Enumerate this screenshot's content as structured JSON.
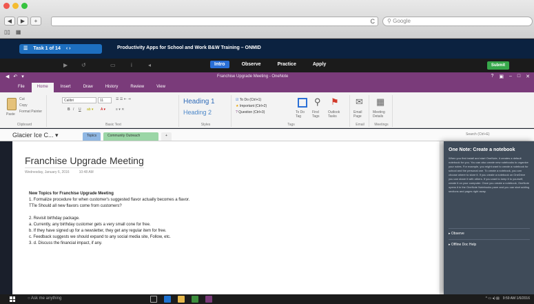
{
  "safari": {
    "search_placeholder": "Google",
    "nav_back": "◀",
    "nav_fwd": "▶",
    "add_tab": "+",
    "reload": "C"
  },
  "training": {
    "task_label": "Task 1 of 14",
    "title": "Productivity Apps for School and Work B&W Training – ONMID",
    "modes": [
      "Intro",
      "Observe",
      "Practice",
      "Apply"
    ],
    "active_mode": "Intro",
    "submit": "Submit"
  },
  "onenote": {
    "window_title": "Franchise Upgrade Meeting - OneNote",
    "tabs": [
      "File",
      "Home",
      "Insert",
      "Draw",
      "History",
      "Review",
      "View"
    ],
    "active_tab": "Home",
    "ribbon": {
      "clipboard_label": "Clipboard",
      "basic_text_label": "Basic Text",
      "styles_label": "Styles",
      "tags_label": "Tags",
      "email_label": "Email",
      "meetings_label": "Meetings",
      "cut": "Cut",
      "copy": "Copy",
      "format_painter": "Format Painter",
      "paste": "Paste",
      "font": "Calibri",
      "font_size": "11",
      "heading1": "Heading 1",
      "heading2": "Heading 2",
      "tag_todo": "To Do (Ctrl+1)",
      "tag_important": "Important (Ctrl+2)",
      "tag_question": "Question (Ctrl+3)",
      "todo_tag": "To Do Tag",
      "find_tags": "Find Tags",
      "outlook_tasks": "Outlook Tasks",
      "email_page": "Email Page",
      "meeting_details": "Meeting Details"
    },
    "notebook": "Glacier Ice C...",
    "section_tabs": [
      "Topics",
      "Community Outreach"
    ],
    "search_text": "Search (Ctrl+E)",
    "page": {
      "title": "Franchise Upgrade Meeting",
      "date": "Wednesday, January 6, 2016",
      "time": "10:48 AM",
      "heading": "New Topics for Franchise Upgrade Meeting",
      "lines": [
        "1.    Formalize procedure for when customer's suggested flavor actually becomes a flavor.",
        "       TTle    Should all new flavors come from customers?",
        "",
        "2.    Revisit birthday package.",
        "            a.    Currently, any birthday customer gets a very small cone for free.",
        "            b.    If they have signed up for a newsletter, they get any regular item for free.",
        "            c.    Feedback suggests we should expand to any social media site, Follow, etc.",
        "        3.  d.    Discuss the financial impact, if any."
      ]
    }
  },
  "tip": {
    "title": "One Note: Create a notebook",
    "body": "When you first install and start OneNote, it creates a default notebook for you. You can also create new notebooks to organize your notes. For example, you might want to create a notebook for school and the personal one. To create a notebook, you can choose where to store it. If you create a notebook on OneDrive you can share it with others. If you want to keep it to yourself, create it on your computer. Once you create a notebook, OneNote opens it in the OneNote Notebooks pane and you can start adding sections and pages right away.",
    "link1": "▸ Observe",
    "link2": "▸ Offline Doc Help"
  },
  "taskbar": {
    "search": "Ask me anything",
    "time": "9:59 AM",
    "date": "1/6/2016"
  }
}
